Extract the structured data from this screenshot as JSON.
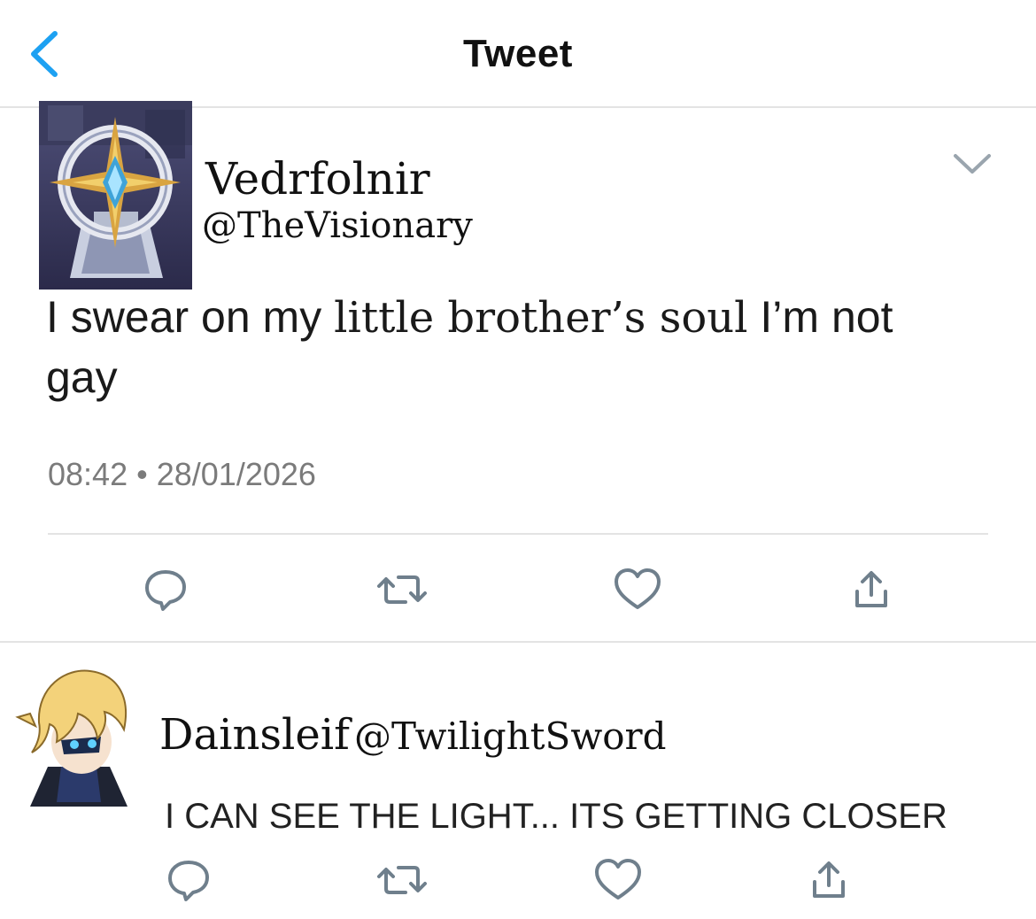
{
  "header": {
    "title": "Tweet",
    "back_icon": "chevron-left-icon",
    "accent": "#1da1f2"
  },
  "tweet": {
    "author_name": "Vedrfolnir",
    "author_handle": "@TheVisionary",
    "avatar_icon": "compass-artifact-avatar",
    "text_part1": "I swear on my",
    "text_part2": "little brother’s soul",
    "text_part3": "I’m not",
    "text_line2": "gay",
    "time": "08:42",
    "separator": "•",
    "date": "28/01/2026",
    "menu_icon": "chevron-down-icon",
    "actions": [
      "reply-icon",
      "retweet-icon",
      "like-icon",
      "share-icon"
    ]
  },
  "reply": {
    "author_name": "Dainsleif",
    "author_handle": "@TwilightSword",
    "avatar_icon": "blonde-character-avatar",
    "text": "I CAN SEE THE LIGHT... ITS GETTING CLOSER",
    "actions": [
      "reply-icon",
      "retweet-icon",
      "like-icon",
      "share-icon"
    ]
  },
  "colors": {
    "text": "#1a1a1a",
    "secondary": "#7b7b7b",
    "icon": "#6f7f8c",
    "divider": "#e3e3e3"
  }
}
